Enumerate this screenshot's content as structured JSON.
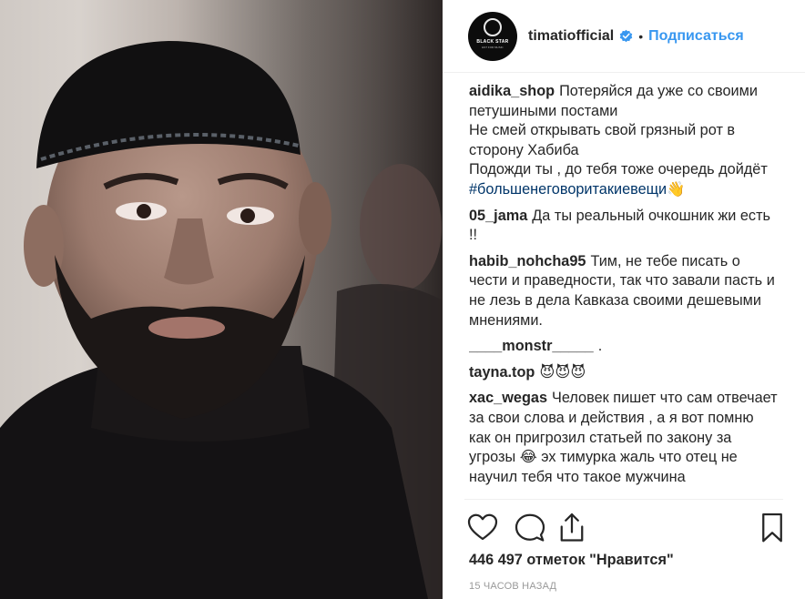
{
  "post": {
    "author": "timatiofficial",
    "follow_label": "Подписаться",
    "separator": "•",
    "avatar_brand": "BLACK STAR",
    "avatar_tag": "EST FOR MUSIC"
  },
  "comments": [
    {
      "user": "aidika_shop",
      "text": "Потеряйся да уже со своими петушиными постами\nНе смей открывать свой грязный рот в сторону Хабиба\nПодожди ты , до тебя тоже очередь дойдёт ",
      "hashtag": "#большенеговоритакиевещи",
      "emoji": "👋"
    },
    {
      "user": "05_jama",
      "text": "Да ты реальный очкошник жи есть !!"
    },
    {
      "user": "habib_nohcha95",
      "text": "Тим, не тебе писать о чести и праведности, так что завали пасть и не лезь в дела Кавказа своими дешевыми мнениями."
    },
    {
      "user": "____monstr_____",
      "text": "."
    },
    {
      "user": "tayna.top",
      "text": "😈😈😈"
    },
    {
      "user": "xac_wegas",
      "text": "Человек пишет что сам отвечает за свои слова и действия , а я вот помню как он пригрозил статьей по закону за угрозы 😂 эх тимурка жаль что отец не научил тебя что такое мужчина"
    }
  ],
  "likes_text": "446 497 отметок \"Нравится\"",
  "time_text": "15 ЧАСОВ НАЗАД",
  "icons": {
    "like": "heart-icon",
    "comment": "comment-icon",
    "share": "share-icon",
    "save": "bookmark-icon",
    "verified": "verified-badge-icon"
  },
  "colors": {
    "link": "#3897f0",
    "text": "#262626",
    "muted": "#999999",
    "hashtag": "#003569"
  }
}
